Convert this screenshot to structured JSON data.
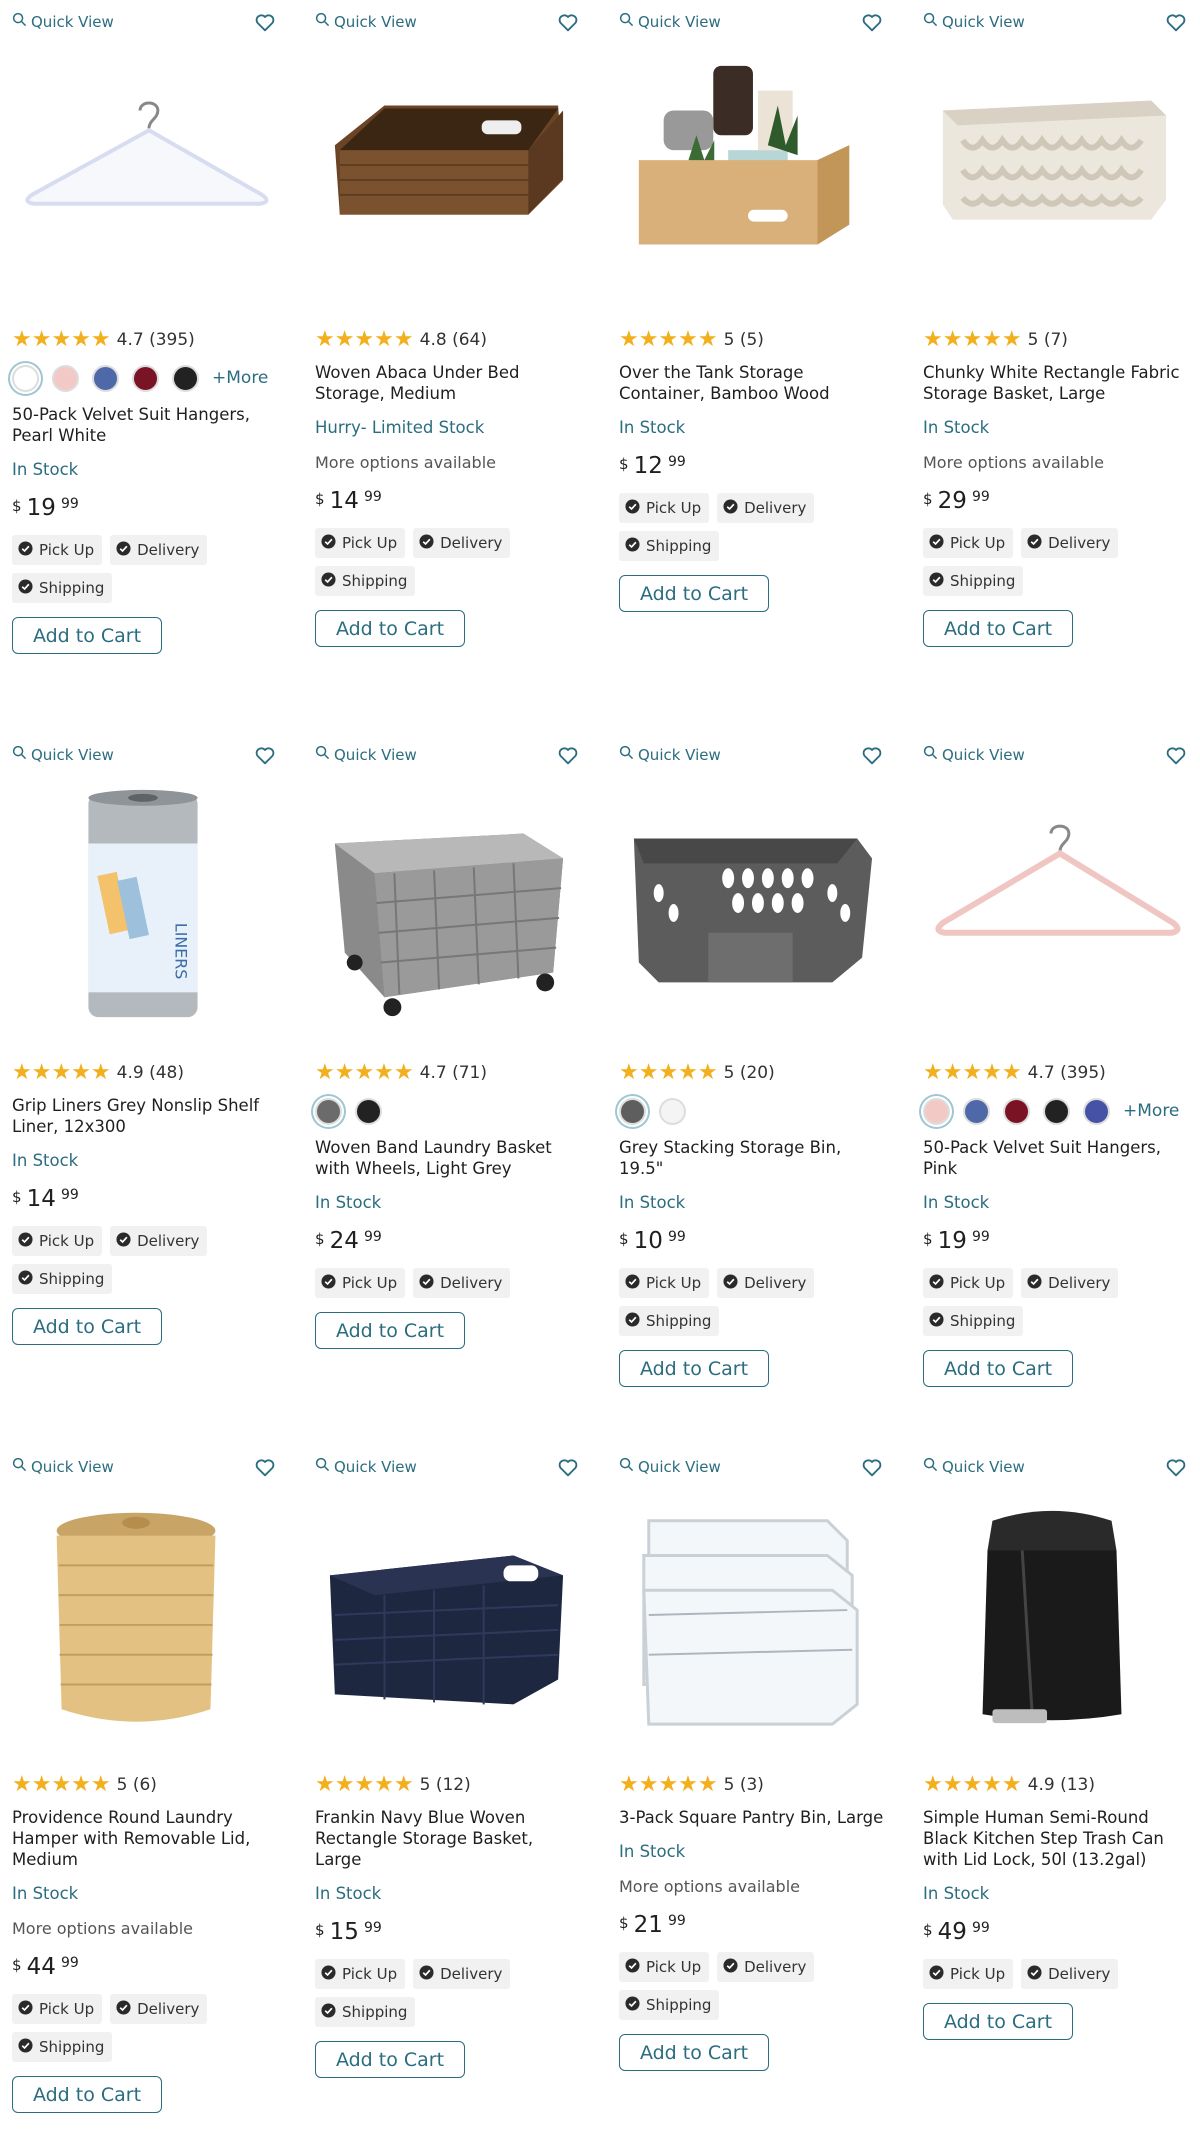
{
  "ui": {
    "quick_view": "Quick View",
    "add_to_cart": "Add to Cart",
    "pickup": "Pick Up",
    "delivery": "Delivery",
    "shipping": "Shipping",
    "stars": "★★★★★",
    "currency": "$",
    "colors": {
      "accent": "#2b6d80",
      "star": "#f2b01e",
      "chip_bg": "#f1f1f1"
    }
  },
  "products": [
    {
      "title": "50-Pack Velvet Suit Hangers, Pearl White",
      "rating": "4.7 (395)",
      "swatches": [
        "#ffffff",
        "#f3c9c6",
        "#4f68a8",
        "#7a1425",
        "#222222"
      ],
      "more_colors": "+More",
      "stock": "In Stock",
      "options": "",
      "price_dollars": "19",
      "price_cents": "99",
      "fulfillment": [
        "pickup",
        "delivery",
        "shipping"
      ],
      "image": "white-hanger"
    },
    {
      "title": "Woven Abaca Under Bed Storage, Medium",
      "rating": "4.8 (64)",
      "swatches": [],
      "more_colors": "",
      "stock": "Hurry- Limited Stock",
      "options": "More options available",
      "price_dollars": "14",
      "price_cents": "99",
      "fulfillment": [
        "pickup",
        "delivery",
        "shipping"
      ],
      "image": "abaca-basket"
    },
    {
      "title": "Over the Tank Storage Container, Bamboo Wood",
      "rating": "5 (5)",
      "swatches": [],
      "more_colors": "",
      "stock": "In Stock",
      "options": "",
      "price_dollars": "12",
      "price_cents": "99",
      "fulfillment": [
        "pickup",
        "delivery",
        "shipping"
      ],
      "image": "bamboo-box"
    },
    {
      "title": "Chunky White Rectangle Fabric Storage Basket, Large",
      "rating": "5 (7)",
      "swatches": [],
      "more_colors": "",
      "stock": "In Stock",
      "options": "More options available",
      "price_dollars": "29",
      "price_cents": "99",
      "fulfillment": [
        "pickup",
        "delivery",
        "shipping"
      ],
      "image": "chunky-basket"
    },
    {
      "title": "Grip Liners Grey Nonslip Shelf Liner, 12x300",
      "rating": "4.9 (48)",
      "swatches": [],
      "more_colors": "",
      "stock": "In Stock",
      "options": "",
      "price_dollars": "14",
      "price_cents": "99",
      "fulfillment": [
        "pickup",
        "delivery",
        "shipping"
      ],
      "image": "liner-roll"
    },
    {
      "title": "Woven Band Laundry Basket with Wheels, Light Grey",
      "rating": "4.7 (71)",
      "swatches": [
        "#6b6b6b",
        "#222222"
      ],
      "more_colors": "",
      "stock": "In Stock",
      "options": "",
      "price_dollars": "24",
      "price_cents": "99",
      "fulfillment": [
        "pickup",
        "delivery"
      ],
      "image": "grey-laundry"
    },
    {
      "title": "Grey Stacking Storage Bin, 19.5\"",
      "rating": "5 (20)",
      "swatches": [
        "#5e5e5e",
        "#f4f4f4"
      ],
      "more_colors": "",
      "stock": "In Stock",
      "options": "",
      "price_dollars": "10",
      "price_cents": "99",
      "fulfillment": [
        "pickup",
        "delivery",
        "shipping"
      ],
      "image": "stacking-bin"
    },
    {
      "title": "50-Pack Velvet Suit Hangers, Pink",
      "rating": "4.7 (395)",
      "swatches": [
        "#f3c9c6",
        "#4f68a8",
        "#7a1425",
        "#222222",
        "#4652a6"
      ],
      "more_colors": "+More",
      "stock": "In Stock",
      "options": "",
      "price_dollars": "19",
      "price_cents": "99",
      "fulfillment": [
        "pickup",
        "delivery",
        "shipping"
      ],
      "image": "pink-hanger"
    },
    {
      "title": "Providence Round Laundry Hamper with Removable Lid, Medium",
      "rating": "5 (6)",
      "swatches": [],
      "more_colors": "",
      "stock": "In Stock",
      "options": "More options available",
      "price_dollars": "44",
      "price_cents": "99",
      "fulfillment": [
        "pickup",
        "delivery",
        "shipping"
      ],
      "image": "round-hamper"
    },
    {
      "title": "Frankin Navy Blue Woven Rectangle Storage Basket, Large",
      "rating": "5 (12)",
      "swatches": [],
      "more_colors": "",
      "stock": "In Stock",
      "options": "",
      "price_dollars": "15",
      "price_cents": "99",
      "fulfillment": [
        "pickup",
        "delivery",
        "shipping"
      ],
      "image": "navy-basket"
    },
    {
      "title": "3-Pack Square Pantry Bin, Large",
      "rating": "5 (3)",
      "swatches": [],
      "more_colors": "",
      "stock": "In Stock",
      "options": "More options available",
      "price_dollars": "21",
      "price_cents": "99",
      "fulfillment": [
        "pickup",
        "delivery",
        "shipping"
      ],
      "image": "clear-bins"
    },
    {
      "title": "Simple Human Semi-Round Black Kitchen Step Trash Can with Lid Lock, 50l (13.2gal)",
      "rating": "4.9 (13)",
      "swatches": [],
      "more_colors": "",
      "stock": "In Stock",
      "options": "",
      "price_dollars": "49",
      "price_cents": "99",
      "fulfillment": [
        "pickup",
        "delivery"
      ],
      "image": "trash-can"
    }
  ]
}
